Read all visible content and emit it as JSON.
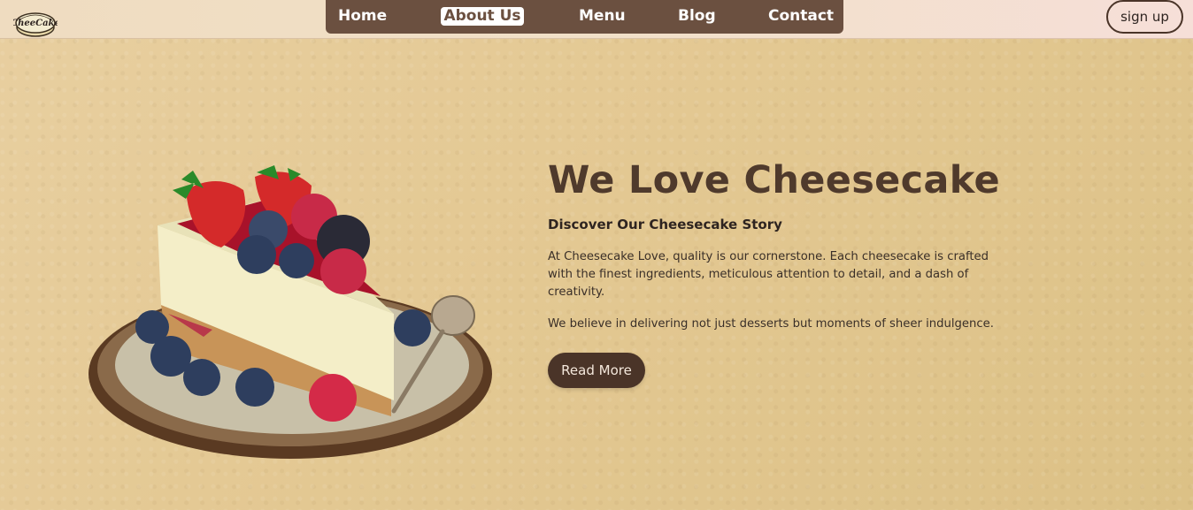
{
  "brand": {
    "logo_text": "CheeCake"
  },
  "nav": {
    "items": [
      {
        "label": "Home"
      },
      {
        "label": "About Us"
      },
      {
        "label": "Menu"
      },
      {
        "label": "Blog"
      },
      {
        "label": "Contact"
      }
    ],
    "active": "About Us"
  },
  "auth": {
    "signup_label": "sign up"
  },
  "hero": {
    "title": "We Love Cheesecake",
    "subtitle": "Discover Our Cheesecake Story",
    "paragraph_1": "At Cheesecake Love, quality is our cornerstone. Each cheesecake is crafted with the finest ingredients, meticulous attention to detail, and a dash of creativity.",
    "paragraph_2": "We believe in delivering not just desserts but moments of sheer indulgence.",
    "cta_label": "Read More"
  },
  "colors": {
    "accent": "#4a3428",
    "nav_bg": "#6b5040",
    "page_bg": "#e4c994"
  }
}
